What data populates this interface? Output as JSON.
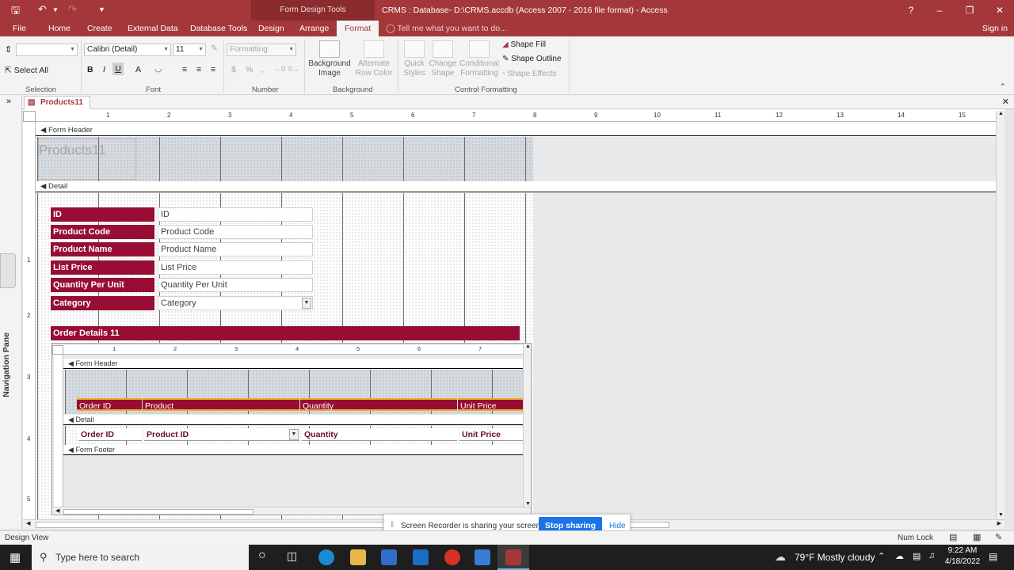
{
  "titlebar": {
    "context_tools": "Form Design Tools",
    "title": "CRMS : Database- D:\\CRMS.accdb (Access 2007 - 2016 file format) - Access",
    "help": "?"
  },
  "tabs": {
    "file": "File",
    "home": "Home",
    "create": "Create",
    "external_data": "External Data",
    "database_tools": "Database Tools",
    "design": "Design",
    "arrange": "Arrange",
    "format": "Format",
    "tell_me": "Tell me what you want to do...",
    "sign_in": "Sign in"
  },
  "ribbon": {
    "selection": {
      "select_all": "Select All",
      "label": "Selection"
    },
    "font": {
      "font_name": "Calibri (Detail)",
      "font_size": "11",
      "bold": "B",
      "italic": "I",
      "underline": "U",
      "font_color": "A",
      "label": "Font"
    },
    "number": {
      "format": "Formatting",
      "currency": "$",
      "percent": "%",
      "comma": ",",
      "label": "Number"
    },
    "background": {
      "background_image": "Background Image",
      "alternate_row_color": "Alternate Row Color",
      "label": "Background"
    },
    "control_formatting": {
      "quick_styles": "Quick Styles",
      "change_shape": "Change Shape",
      "conditional_formatting": "Conditional Formatting",
      "shape_fill": "Shape Fill",
      "shape_outline": "Shape Outline",
      "shape_effects": "Shape Effects",
      "label": "Control Formatting"
    }
  },
  "document": {
    "tab_title": "Products11",
    "nav_pane": "Navigation Pane"
  },
  "form": {
    "form_header": "Form Header",
    "title": "Products11",
    "detail": "Detail",
    "fields": [
      {
        "label": "ID",
        "value": "ID"
      },
      {
        "label": "Product Code",
        "value": "Product Code"
      },
      {
        "label": "Product Name",
        "value": "Product Name"
      },
      {
        "label": "List Price",
        "value": "List Price"
      },
      {
        "label": "Quantity Per Unit",
        "value": "Quantity Per Unit"
      },
      {
        "label": "Category",
        "value": "Category"
      }
    ],
    "subform_label": "Order Details 11",
    "ruler_numbers": [
      "1",
      "2",
      "3",
      "4",
      "5",
      "6",
      "7",
      "8",
      "9",
      "10",
      "11",
      "12",
      "13",
      "14",
      "15"
    ],
    "v_ruler_numbers": [
      "1",
      "2",
      "3",
      "4",
      "5"
    ]
  },
  "subform": {
    "form_header": "Form Header",
    "detail": "Detail",
    "form_footer": "Form Footer",
    "header_labels": [
      "Order ID",
      "Product",
      "Quantity",
      "Unit Price"
    ],
    "detail_fields": [
      "Order ID",
      "Product ID",
      "Quantity",
      "Unit Price"
    ],
    "ruler_numbers": [
      "1",
      "2",
      "3",
      "4",
      "5",
      "6",
      "7"
    ]
  },
  "status": {
    "view": "Design View",
    "num_lock": "Num Lock"
  },
  "recorder": {
    "message": "Screen Recorder is sharing your screen.",
    "stop": "Stop sharing",
    "hide": "Hide"
  },
  "taskbar": {
    "search_placeholder": "Type here to search",
    "weather": "79°F  Mostly cloudy",
    "time": "9:22 AM",
    "date": "4/18/2022"
  },
  "colors": {
    "accent": "#a4373a",
    "label_fill": "#970d34",
    "selection": "#f5a623"
  }
}
